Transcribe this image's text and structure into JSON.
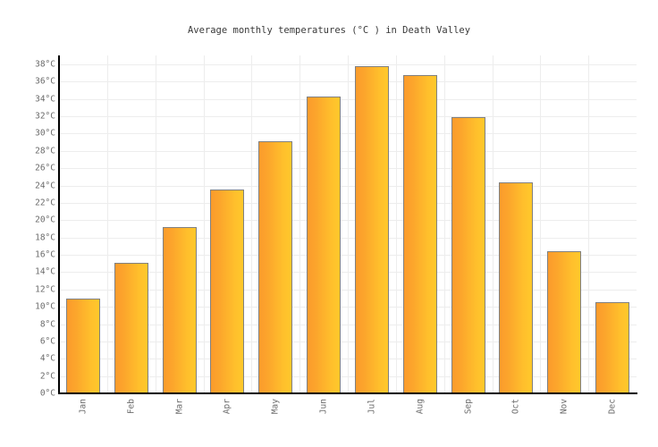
{
  "chart_data": {
    "type": "bar",
    "title": "Average monthly temperatures (°C ) in Death Valley",
    "xlabel": "",
    "ylabel": "",
    "categories": [
      "Jan",
      "Feb",
      "Mar",
      "Apr",
      "May",
      "Jun",
      "Jul",
      "Aug",
      "Sep",
      "Oct",
      "Nov",
      "Dec"
    ],
    "values": [
      10.9,
      15.1,
      19.2,
      23.5,
      29.1,
      34.3,
      37.8,
      36.8,
      31.9,
      24.4,
      16.4,
      10.5
    ],
    "unit": "°C",
    "ylim": [
      0,
      38
    ],
    "ytick_step": 2,
    "ytick_labels": [
      "38°C",
      "36°C",
      "34°C",
      "32°C",
      "30°C",
      "28°C",
      "26°C",
      "24°C",
      "22°C",
      "20°C",
      "18°C",
      "16°C",
      "14°C",
      "12°C",
      "10°C",
      "8°C",
      "6°C",
      "4°C",
      "2°C",
      "0°C"
    ],
    "ytick_values": [
      38,
      36,
      34,
      32,
      30,
      28,
      26,
      24,
      22,
      20,
      18,
      16,
      14,
      12,
      10,
      8,
      6,
      4,
      2,
      0
    ],
    "grid": true,
    "legend": false,
    "legend_position": "none",
    "colors": {
      "bar_gradient_left": "#fb9b2c",
      "bar_gradient_right": "#ffc82b",
      "bar_border": "#808080",
      "gridline": "#ededed",
      "axis": "#000000",
      "tick_label": "#6b6b6b",
      "title": "#3a3a3a",
      "background": "#ffffff"
    }
  }
}
